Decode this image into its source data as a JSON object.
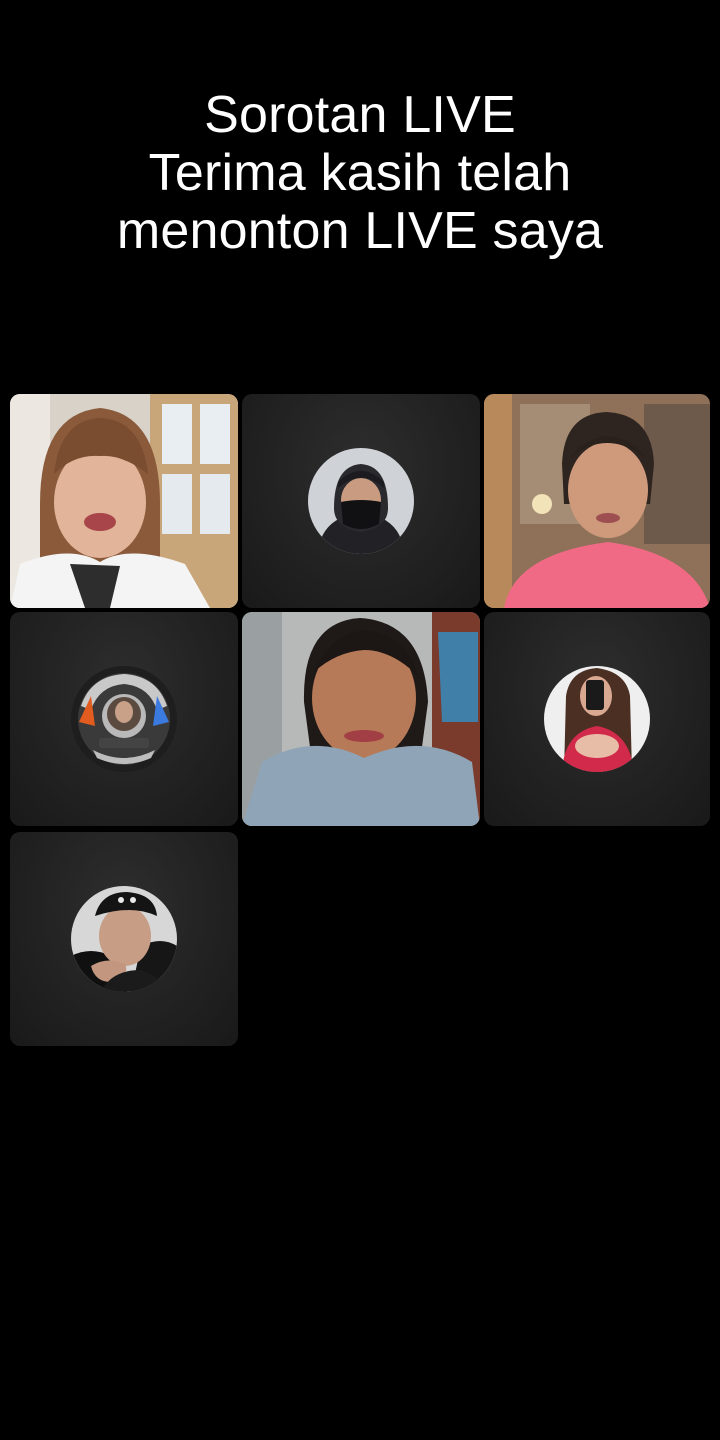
{
  "header": {
    "line1": "Sorotan LIVE",
    "line2": "Terima kasih telah",
    "line3": "menonton LIVE saya"
  },
  "participants": [
    {
      "kind": "video",
      "icon": "participant-video-woman-bangs"
    },
    {
      "kind": "avatar",
      "icon": "avatar-masked-person"
    },
    {
      "kind": "video",
      "icon": "participant-video-woman-pink-shirt"
    },
    {
      "kind": "avatar",
      "icon": "avatar-emblem-badge"
    },
    {
      "kind": "video",
      "icon": "participant-video-woman-closeup"
    },
    {
      "kind": "avatar",
      "icon": "avatar-woman-mirror-selfie"
    },
    {
      "kind": "avatar",
      "icon": "avatar-man-bandana"
    }
  ],
  "colors": {
    "background": "#000000",
    "text": "#ffffff",
    "tile": "#252525"
  }
}
